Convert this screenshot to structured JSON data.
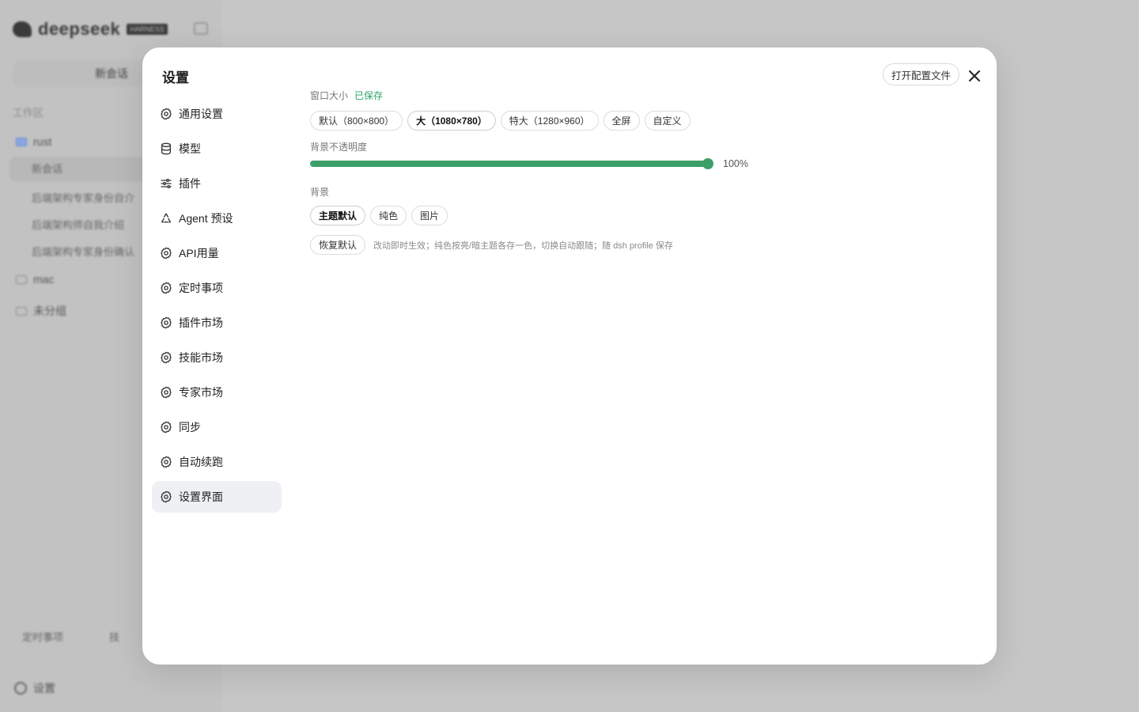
{
  "background_app": {
    "brand": "deepseek",
    "brand_tag": "HARNESS",
    "new_chat": "新会话",
    "section_label": "工作区",
    "folders": [
      {
        "name": "rust"
      },
      {
        "name": "mac"
      },
      {
        "name": "未分组"
      }
    ],
    "chats": [
      "新会话",
      "后端架构专家身份自介",
      "后端架构师自我介绍",
      "后端架构专家身份确认"
    ],
    "bottom_left": "定时事项",
    "bottom_right": "技",
    "settings": "设置"
  },
  "modal": {
    "title": "设置",
    "open_config_label": "打开配置文件",
    "nav": [
      {
        "label": "通用设置",
        "icon": "gear-icon"
      },
      {
        "label": "模型",
        "icon": "database-icon"
      },
      {
        "label": "插件",
        "icon": "sliders-icon"
      },
      {
        "label": "Agent 预设",
        "icon": "recycle-icon"
      },
      {
        "label": "API用量",
        "icon": "gear-icon"
      },
      {
        "label": "定时事项",
        "icon": "gear-icon"
      },
      {
        "label": "插件市场",
        "icon": "gear-icon"
      },
      {
        "label": "技能市场",
        "icon": "gear-icon"
      },
      {
        "label": "专家市场",
        "icon": "gear-icon"
      },
      {
        "label": "同步",
        "icon": "gear-icon"
      },
      {
        "label": "自动续跑",
        "icon": "gear-icon"
      },
      {
        "label": "设置界面",
        "icon": "gear-icon",
        "active": true
      }
    ]
  },
  "window_size": {
    "label": "窗口大小",
    "status": "已保存",
    "options": [
      "默认（800×800）",
      "大（1080×780）",
      "特大（1280×960）",
      "全屏",
      "自定义"
    ],
    "selected": "大（1080×780）"
  },
  "opacity": {
    "label": "背景不透明度",
    "value": 100,
    "value_text": "100%"
  },
  "background": {
    "label": "背景",
    "options": [
      "主题默认",
      "纯色",
      "图片"
    ],
    "selected": "主题默认"
  },
  "reset": {
    "label": "恢复默认",
    "hint": "改动即时生效；纯色按亮/暗主题各存一色，切换自动跟随；随 dsh profile 保存"
  },
  "colors": {
    "accent": "#3d9f68",
    "saved_text": "#2fa36b",
    "overlay": "#c9c9c9"
  }
}
